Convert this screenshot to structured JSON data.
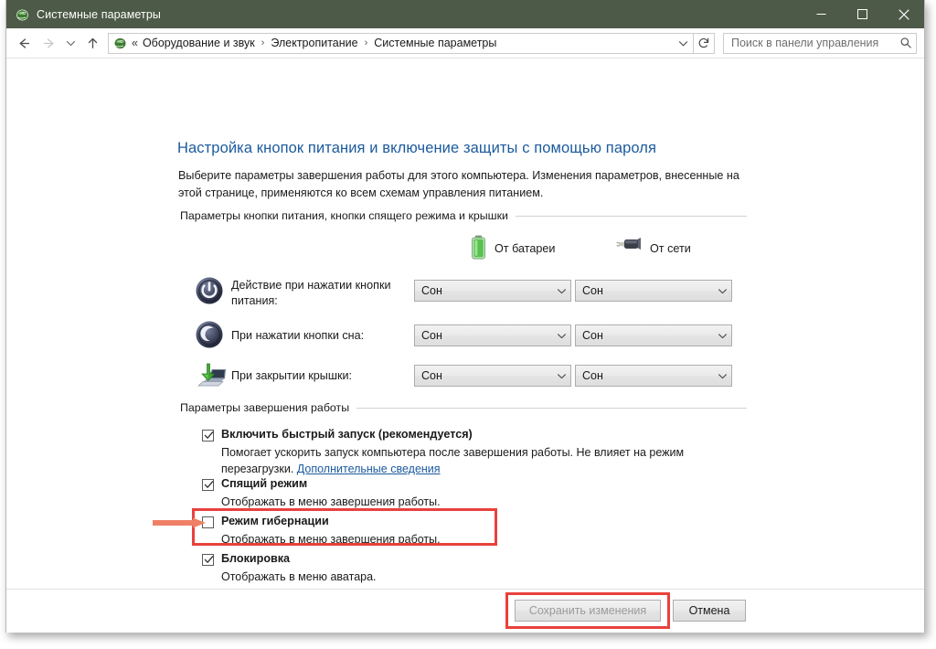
{
  "window": {
    "title": "Системные параметры",
    "icon": "power-options-icon",
    "minimize_label": "Свернуть",
    "maximize_label": "Развернуть",
    "close_label": "Закрыть"
  },
  "navbar": {
    "back_icon": "arrow-left-icon",
    "forward_icon": "arrow-right-icon",
    "history_icon": "chevron-down-icon",
    "up_icon": "arrow-up-icon",
    "address_icon": "power-options-icon",
    "overflow": "«",
    "breadcrumbs": [
      "Оборудование и звук",
      "Электропитание",
      "Системные параметры"
    ],
    "separator": "›",
    "dropdown_icon": "chevron-down-icon",
    "refresh_icon": "refresh-icon",
    "search_placeholder": "Поиск в панели управления",
    "search_value": "",
    "search_icon": "search-icon"
  },
  "page": {
    "title": "Настройка кнопок питания и включение защиты с помощью пароля",
    "description": "Выберите параметры завершения работы для этого компьютера. Изменения параметров, внесенные на этой странице, применяются ко всем схемам управления питанием."
  },
  "button_group": {
    "header": "Параметры кнопки питания, кнопки спящего режима и крышки",
    "columns": [
      {
        "label": "От батареи",
        "icon": "battery-icon"
      },
      {
        "label": "От сети",
        "icon": "power-plug-icon"
      }
    ],
    "rows": [
      {
        "icon": "power-button-icon",
        "label": "Действие при нажатии кнопки питания:",
        "battery_value": "Сон",
        "ac_value": "Сон"
      },
      {
        "icon": "sleep-moon-icon",
        "label": "При нажатии кнопки сна:",
        "battery_value": "Сон",
        "ac_value": "Сон"
      },
      {
        "icon": "laptop-lid-icon",
        "label": "При закрытии крышки:",
        "battery_value": "Сон",
        "ac_value": "Сон"
      }
    ]
  },
  "shutdown_group": {
    "header": "Параметры завершения работы",
    "items": [
      {
        "title": "Включить быстрый запуск (рекомендуется)",
        "checked": true,
        "description": "Помогает ускорить запуск компьютера после завершения работы. Не влияет на режим перезагрузки.",
        "link": "Дополнительные сведения"
      },
      {
        "title": "Спящий режим",
        "checked": true,
        "description": "Отображать в меню завершения работы.",
        "link": ""
      },
      {
        "title": "Режим гибернации",
        "checked": false,
        "description": "Отображать в меню завершения работы.",
        "link": ""
      },
      {
        "title": "Блокировка",
        "checked": true,
        "description": "Отображать в меню аватара.",
        "link": ""
      }
    ]
  },
  "footer": {
    "save_label": "Сохранить изменения",
    "save_disabled": true,
    "cancel_label": "Отмена"
  },
  "annotations": {
    "highlight_color": "#e8413c",
    "arrow_color": "#ef8066",
    "hibernate_box": "Режим гибернации",
    "save_box": "Сохранить изменения"
  },
  "colors": {
    "titlebar": "#4d5a47",
    "accent_link": "#1b5a9e",
    "battery_green": "#5ec45e",
    "annotation_red": "#e8413c"
  }
}
